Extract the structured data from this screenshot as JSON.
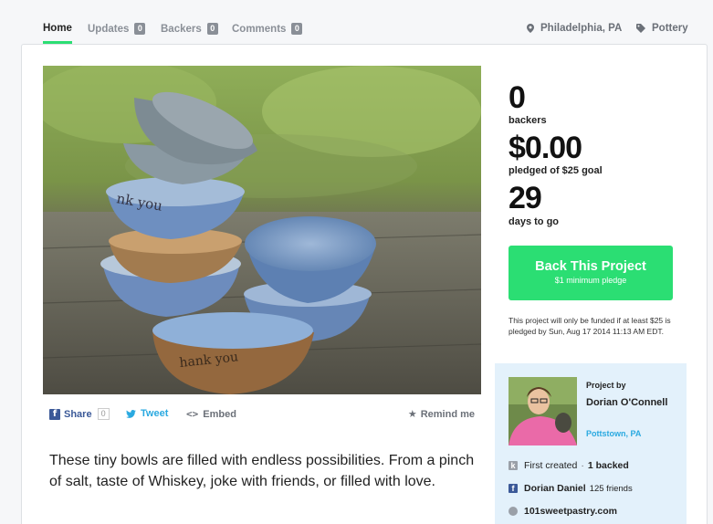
{
  "nav": {
    "tabs": [
      {
        "label": "Home"
      },
      {
        "label": "Updates",
        "count": "0"
      },
      {
        "label": "Backers",
        "count": "0"
      },
      {
        "label": "Comments",
        "count": "0"
      }
    ],
    "location": "Philadelphia, PA",
    "category": "Pottery"
  },
  "share": {
    "facebook_label": "Share",
    "facebook_count": "0",
    "tweet_label": "Tweet",
    "embed_label": "Embed",
    "remind_label": "Remind me"
  },
  "blurb": "These tiny bowls are filled with endless possibilities. From a pinch of salt, taste of Whiskey, joke with friends, or filled with love.",
  "stats": {
    "backers_value": "0",
    "backers_label": "backers",
    "pledged_value": "$0.00",
    "pledged_label": "pledged of $25 goal",
    "days_value": "29",
    "days_label": "days to go"
  },
  "cta": {
    "label": "Back This Project",
    "sublabel": "$1 minimum pledge"
  },
  "funding_note": "This project will only be funded if at least $25 is pledged by Sun, Aug 17 2014 11:13 AM EDT.",
  "creator": {
    "heading": "Project by",
    "name": "Dorian O'Connell",
    "location": "Pottstown, PA",
    "first_created": "First created",
    "backed": "1 backed",
    "fb_name": "Dorian Daniel",
    "fb_friends": "125 friends",
    "website": "101sweetpastry.com"
  },
  "colors": {
    "accent": "#2bde73",
    "link": "#2aa9e0",
    "facebook": "#3b5998",
    "creator_bg": "#e3f1fb"
  }
}
